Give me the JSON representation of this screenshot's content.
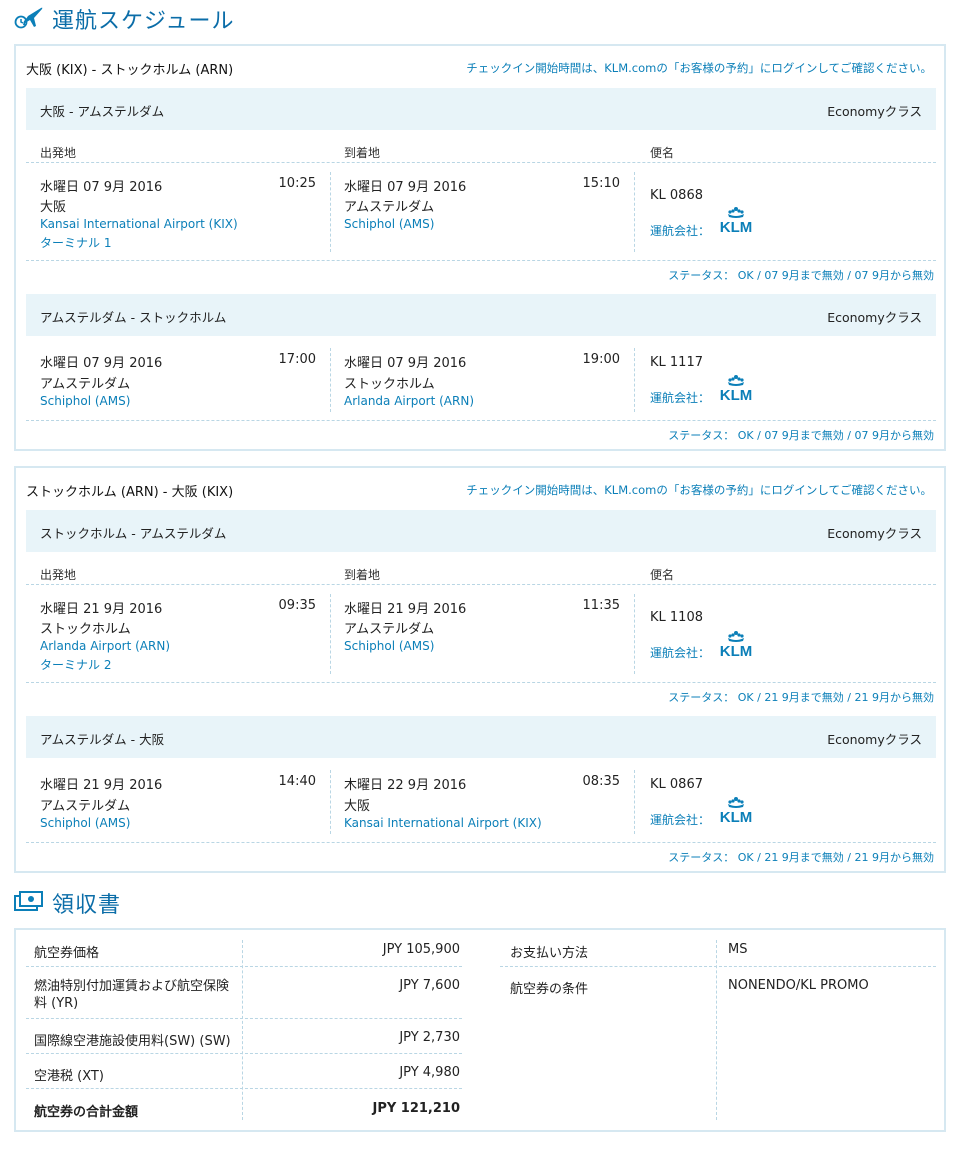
{
  "schedule": {
    "title": "運航スケジュール",
    "icon": "plane-clock-icon",
    "col_from": "出発地",
    "col_to": "到着地",
    "col_flight": "便名",
    "operator_label": "運航会社：",
    "journeys": [
      {
        "route": "大阪 (KIX) - ストックホルム (ARN)",
        "checkin_note": "チェックイン開始時間は、KLM.comの「お客様の予約」にログインしてご確認ください。",
        "segments": [
          {
            "name": "大阪 - アムステルダム",
            "cabin": "Economyクラス",
            "dep_date": "水曜日 07 9月 2016",
            "dep_time": "10:25",
            "dep_city": "大阪",
            "dep_airport": "Kansai International Airport (KIX)",
            "dep_terminal": "ターミナル 1",
            "arr_date": "水曜日 07 9月 2016",
            "arr_time": "15:10",
            "arr_city": "アムステルダム",
            "arr_airport": "Schiphol (AMS)",
            "flight": "KL 0868",
            "status": "ステータス： OK / 07 9月まで無効 / 07 9月から無効"
          },
          {
            "name": "アムステルダム - ストックホルム",
            "cabin": "Economyクラス",
            "dep_date": "水曜日 07 9月 2016",
            "dep_time": "17:00",
            "dep_city": "アムステルダム",
            "dep_airport": "Schiphol (AMS)",
            "arr_date": "水曜日 07 9月 2016",
            "arr_time": "19:00",
            "arr_city": "ストックホルム",
            "arr_airport": "Arlanda Airport (ARN)",
            "flight": "KL 1117",
            "status": "ステータス： OK / 07 9月まで無効 / 07 9月から無効"
          }
        ]
      },
      {
        "route": "ストックホルム (ARN) - 大阪 (KIX)",
        "checkin_note": "チェックイン開始時間は、KLM.comの「お客様の予約」にログインしてご確認ください。",
        "segments": [
          {
            "name": "ストックホルム - アムステルダム",
            "cabin": "Economyクラス",
            "dep_date": "水曜日 21 9月 2016",
            "dep_time": "09:35",
            "dep_city": "ストックホルム",
            "dep_airport": "Arlanda Airport (ARN)",
            "dep_terminal": "ターミナル 2",
            "arr_date": "水曜日 21 9月 2016",
            "arr_time": "11:35",
            "arr_city": "アムステルダム",
            "arr_airport": "Schiphol (AMS)",
            "flight": "KL 1108",
            "status": "ステータス： OK / 21 9月まで無効 / 21 9月から無効"
          },
          {
            "name": "アムステルダム - 大阪",
            "cabin": "Economyクラス",
            "dep_date": "水曜日 21 9月 2016",
            "dep_time": "14:40",
            "dep_city": "アムステルダム",
            "dep_airport": "Schiphol (AMS)",
            "arr_date": "木曜日 22 9月 2016",
            "arr_time": "08:35",
            "arr_city": "大阪",
            "arr_airport": "Kansai International Airport (KIX)",
            "flight": "KL 0867",
            "status": "ステータス： OK / 21 9月まで無効 / 21 9月から無効"
          }
        ]
      }
    ]
  },
  "receipt": {
    "title": "領収書",
    "icon": "receipt-icon",
    "rows": [
      {
        "label": "航空券価格",
        "value": "JPY 105,900"
      },
      {
        "label": "燃油特別付加運賃および航空保険料 (YR)",
        "label_line1": "燃油特別付加運賃および航空保険",
        "label_line2": "料 (YR)",
        "value": "JPY 7,600"
      },
      {
        "label": "国際線空港施設使用料(SW) (SW)",
        "value": "JPY 2,730"
      },
      {
        "label": "空港税 (XT)",
        "value": "JPY 4,980"
      },
      {
        "label": "航空券の合計金額",
        "value": "JPY 121,210"
      }
    ],
    "payment_label": "お支払い方法",
    "payment_value": "MS",
    "conditions_label": "航空券の条件",
    "conditions_value": "NONENDO/KL PROMO"
  },
  "colors": {
    "accent": "#0b7fb8",
    "bar": "#e8f4f9",
    "border": "#d6e8f1"
  }
}
